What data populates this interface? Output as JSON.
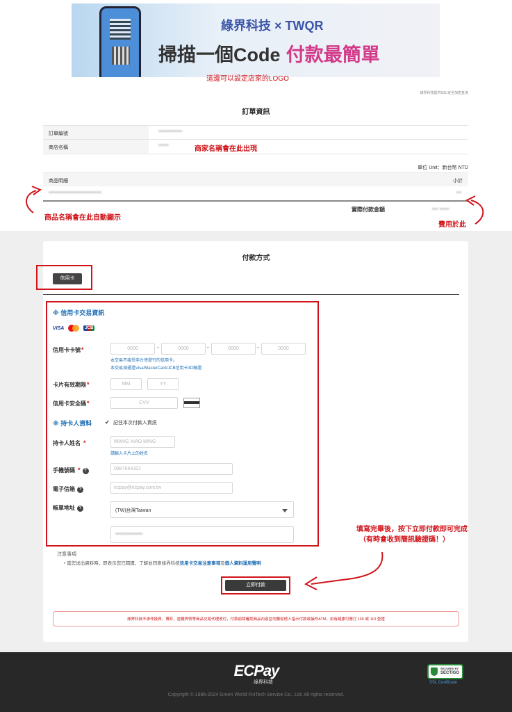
{
  "banner": {
    "brand": "綠界科技 × TWQR",
    "headline_left": "掃描一個Code",
    "headline_right": "付款最簡單",
    "logo_note": "這邊可以設定店家的LOGO"
  },
  "ssl_note": "綠界科技提供SSL安全加密金流",
  "order": {
    "title": "訂單資訊",
    "rows": [
      {
        "label": "訂單編號",
        "value": "••••••••••••••"
      },
      {
        "label": "商店名稱",
        "value": "••••••"
      }
    ],
    "store_note": "商家名稱會在此出現",
    "unit": "單位 Unit：新台幣 NTD",
    "product_header": "商品明細",
    "subtotal_header": "小計",
    "product_value": "•••••••••••••••••••••••••••••••",
    "subtotal_value": "•••",
    "total_label": "實際付款金額",
    "total_value": "••• •••••",
    "product_note": "商品名稱會在此自動顯示",
    "fee_note": "費用於此"
  },
  "payment": {
    "title": "付款方式",
    "tab_label": "信用卡",
    "card_section_title": "※ 信用卡交易資訊",
    "card_brands": [
      "VISA",
      "MasterCard",
      "JCB"
    ],
    "card_number_label": "信用卡卡號",
    "card_number_placeholders": [
      "0000",
      "0000",
      "0000",
      "0000"
    ],
    "card_note_1": "本交易不接受非台灣發行的信用卡。",
    "card_note_2": "本交易須通過Visa/MasterCard/JCB信用卡3D驗證",
    "expiry_label": "卡片有效期限",
    "expiry_mm": "MM",
    "expiry_yy": "YY",
    "cvv_label": "信用卡安全碼",
    "cvv_placeholder": "CVV",
    "holder_section_title": "※ 持卡人資料",
    "remember_label": "記住本次付款人資訊",
    "name_label": "持卡人姓名",
    "name_placeholder": "WANG XIAO MING",
    "name_hint": "請輸入卡片上的姓名",
    "phone_label": "手機號碼",
    "phone_placeholder": "0987654321",
    "email_label": "電子信箱",
    "email_placeholder": "ecpay@ecpay.com.tw",
    "address_label": "帳單地址",
    "country_value": "(TW)台灣Taiwan",
    "address_value": "••••••••••••••••",
    "notice_title": "注意事項",
    "notice_prefix": "當您送出資料時，即表示您已閱讀，了解並同意綠界科技",
    "notice_link1": "信用卡交易注意事項",
    "notice_and": "及",
    "notice_link2": "個人資料運用聲明",
    "submit_label": "立即付款",
    "submit_note_1": "填寫完畢後，按下立即付款即可完成",
    "submit_note_2": "（有時會收到簡訊驗證碼！）",
    "warning": "綠界科技不承作投資、博弈、虛擬貨幣等商品交易代理收付，付款前請確認商品內容並勿聽從他人指示付款或操作ATM，如有疑慮可撥打 165 或 110 查證"
  },
  "footer": {
    "logo": "ECPay",
    "logo_sub": "綠界科技",
    "copyright": "Copyright © 1996-2024 Green World FinTech Service Co., Ltd. All rights reserved.",
    "seal_top": "SECURED BY",
    "seal_brand": "SECTIGO",
    "ssl_cert": "SSL Certificate"
  }
}
